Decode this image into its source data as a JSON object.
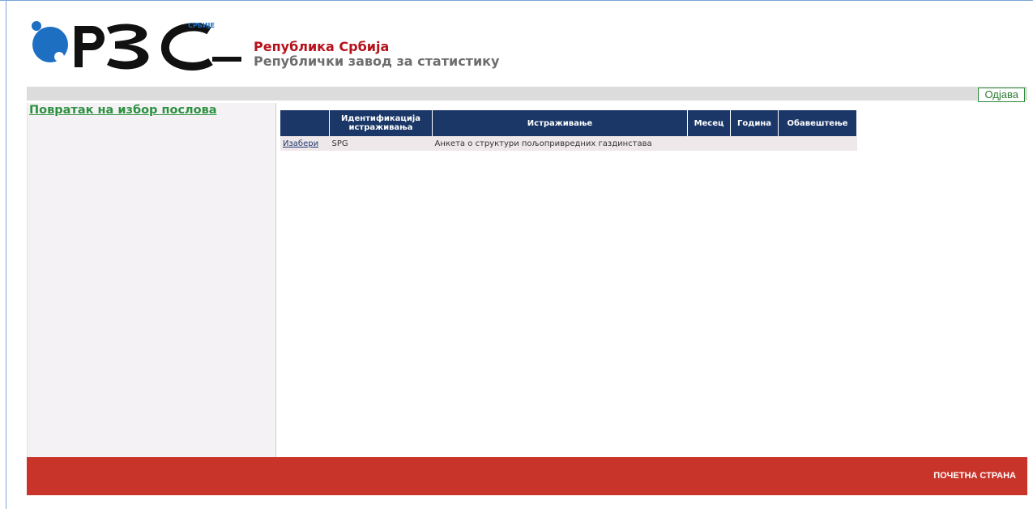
{
  "header": {
    "logo_text": "РЗС",
    "logo_superscript": "СРБИЈЕ",
    "org_line1": "Република Србија",
    "org_line2": "Републички завод за статистику"
  },
  "toolbar": {
    "logout_label": "Одјава"
  },
  "sidebar": {
    "back_link": "Повратак на избор послова"
  },
  "table": {
    "headers": [
      "",
      "Идентификација истраживања",
      "Истраживање",
      "Месец",
      "Година",
      "Обавештење"
    ],
    "rows": [
      {
        "action": "Изабери",
        "id": "SPG",
        "survey": "Анкета о структури пољопривредних газдинстава",
        "month": "",
        "year": "",
        "notice": ""
      }
    ]
  },
  "footer": {
    "home_link": "ПОЧЕТНА СТРАНА"
  },
  "colors": {
    "brand_blue": "#1d6fc2",
    "brand_red": "#b5121b",
    "header_navy": "#1a3767",
    "footer_red": "#c9342a",
    "link_green": "#2e9140"
  }
}
